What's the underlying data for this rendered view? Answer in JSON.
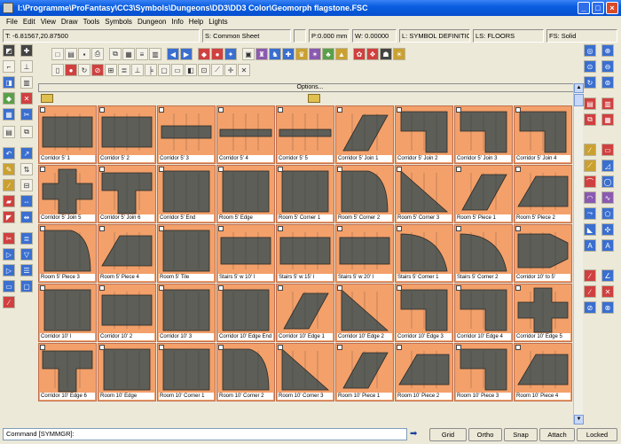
{
  "window": {
    "title": "I:\\Programme\\ProFantasy\\CC3\\Symbols\\Dungeons\\DD3\\DD3 Color\\Geomorph flagstone.FSC"
  },
  "menu": [
    "File",
    "Edit",
    "View",
    "Draw",
    "Tools",
    "Symbols",
    "Dungeon",
    "Info",
    "Help",
    "Lights"
  ],
  "status": {
    "coords": "T: -6.81567,20.87500",
    "sheet": "S: Common Sheet",
    "pen": "P:0.000 mm",
    "width": "W: 0.00000",
    "layer": "L: SYMBOL DEFINITIO",
    "linestyle": "LS: FLOORS",
    "fillstyle": "FS: Solid"
  },
  "options_label": "Options...",
  "symbols": [
    "Corridor 5' 1",
    "Corridor 5' 2",
    "Corridor 5' 3",
    "Corridor 5' 4",
    "Corridor 5' 5",
    "Corridor 5' Join 1",
    "Corridor 5' Join 2",
    "Corridor 5' Join 3",
    "Corridor 5' Join 4",
    "Corridor 5' Join 5",
    "Corridor 5' Join 6",
    "Corridor 5' End",
    "Room 5' Edge",
    "Room 5' Corner 1",
    "Room 5' Corner 2",
    "Room 5' Corner 3",
    "Room 5' Piece 1",
    "Room 5' Piece 2",
    "Room 5' Piece 3",
    "Room 5' Piece 4",
    "Room 5' Tile",
    "Stairs 5' w 10' l",
    "Stairs 5' w 15' l",
    "Stairs 5' w 20' l",
    "Stairs 5' Corner 1",
    "Stairs 5' Corner 2",
    "Corridor 10' to 5'",
    "Corridor 10' l",
    "Corridor 10' 2",
    "Corridor 10' 3",
    "Corridor 10' Edge End",
    "Corridor 10' Edge 1",
    "Corridor 10' Edge 2",
    "Corridor 10' Edge 3",
    "Corridor 10' Edge 4",
    "Corridor 10' Edge 5",
    "Corridor 10' Edge 6",
    "Room 10' Edge",
    "Room 10' Corner 1",
    "Room 10' Corner 2",
    "Room 10' Corner 3",
    "Room 10' Piece 1",
    "Room 10' Piece 2",
    "Room 10' Piece 3",
    "Room 10' Piece 4"
  ],
  "command": {
    "prompt": "Command [SYMMGR]:",
    "buttons": [
      "Grid",
      "Ortho",
      "Snap",
      "Attach",
      "Locked"
    ]
  },
  "colors": {
    "tile_bg": "#f3a06a",
    "stone": "#5e5e58",
    "titlebar": "#0a5ee0"
  }
}
